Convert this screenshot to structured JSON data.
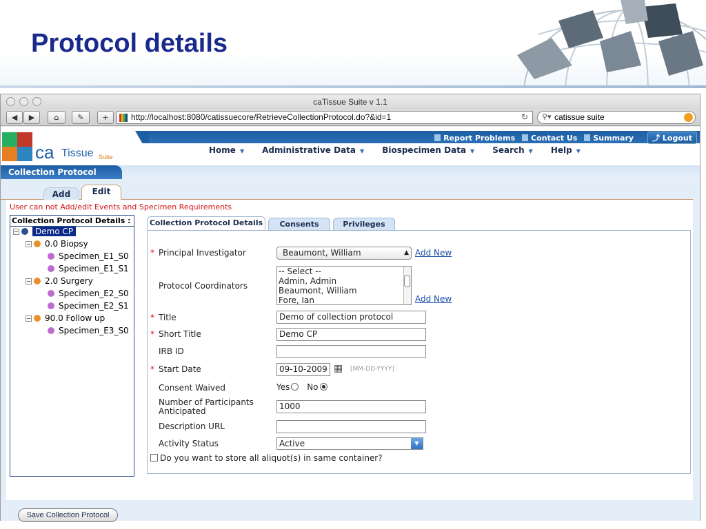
{
  "slide": {
    "title": "Protocol details"
  },
  "browser": {
    "window_title": "caTissue Suite v 1.1",
    "url": "http://localhost:8080/catissuecore/RetrieveCollectionProtocol.do?&id=1",
    "search_value": "catissue suite",
    "reload_glyph": "↻"
  },
  "app": {
    "logo": {
      "ca": "ca",
      "tissue": "Tissue",
      "suite": "Suite"
    },
    "toplinks": {
      "report": "Report Problems",
      "contact": "Contact Us",
      "summary": "Summary",
      "logout": "Logout"
    },
    "nav": {
      "home": "Home",
      "admin": "Administrative Data",
      "biospecimen": "Biospecimen Data",
      "search": "Search",
      "help": "Help"
    },
    "section_title": "Collection Protocol",
    "tabs": {
      "add": "Add",
      "edit": "Edit"
    },
    "warning": "User can not Add/edit Events and Specimen Requirements"
  },
  "tree": {
    "heading": "Collection Protocol Details :",
    "root": "Demo CP",
    "events": [
      {
        "label": "0.0 Biopsy",
        "specimens": [
          "Specimen_E1_S0",
          "Specimen_E1_S1"
        ]
      },
      {
        "label": "2.0 Surgery",
        "specimens": [
          "Specimen_E2_S0",
          "Specimen_E2_S1"
        ]
      },
      {
        "label": "90.0 Follow up",
        "specimens": [
          "Specimen_E3_S0"
        ]
      }
    ]
  },
  "subtabs": {
    "details": "Collection Protocol Details",
    "consents": "Consents",
    "privileges": "Privileges"
  },
  "form": {
    "pi_label": "Principal Investigator",
    "pi_value": "Beaumont, William",
    "add_new": "Add New",
    "coord_label": "Protocol Coordinators",
    "coord_options": [
      "-- Select --",
      "Admin, Admin",
      "Beaumont, William",
      "Fore, Ian"
    ],
    "title_label": "Title",
    "title_value": "Demo of collection protocol",
    "short_label": "Short Title",
    "short_value": "Demo CP",
    "irb_label": "IRB ID",
    "irb_value": "",
    "start_label": "Start Date",
    "start_value": "09-10-2009",
    "start_hint": "[MM-DD-YYYY]",
    "consent_label": "Consent Waived",
    "consent_yes": "Yes",
    "consent_no": "No",
    "consent_selected": "No",
    "participants_label_1": "Number of Participants",
    "participants_label_2": "Anticipated",
    "participants_value": "1000",
    "desc_label": "Description URL",
    "desc_value": "",
    "activity_label": "Activity Status",
    "activity_value": "Active",
    "aliquot_label": "Do you want to store all aliquot(s) in same container?"
  },
  "save_button": "Save Collection Protocol"
}
